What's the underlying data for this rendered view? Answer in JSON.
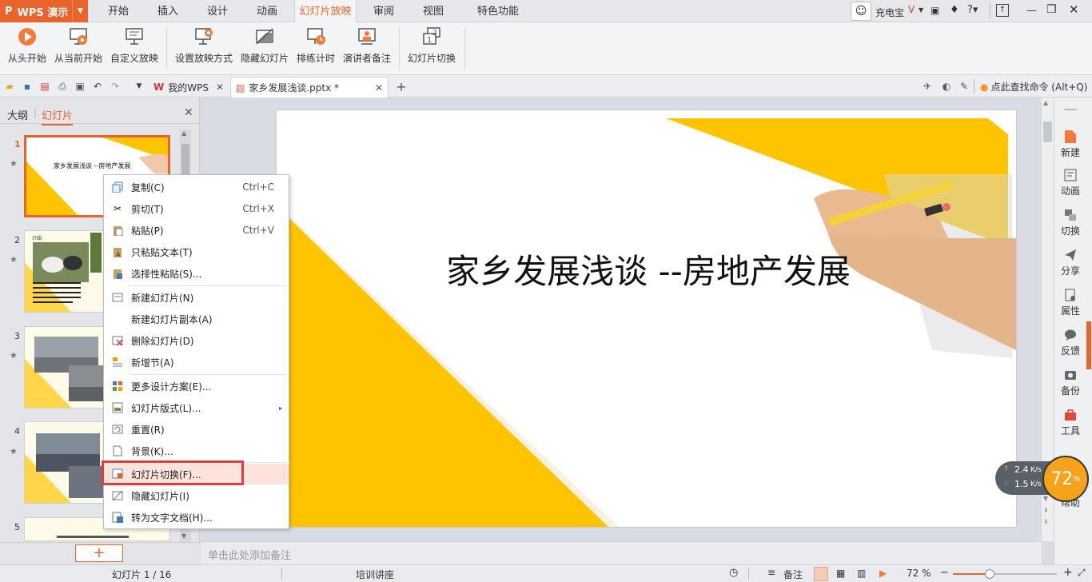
{
  "app": {
    "name": "WPS 演示",
    "logo": "P"
  },
  "tabs": [
    {
      "label": "开始"
    },
    {
      "label": "插入"
    },
    {
      "label": "设计"
    },
    {
      "label": "动画"
    },
    {
      "label": "幻灯片放映",
      "active": true
    },
    {
      "label": "审阅"
    },
    {
      "label": "视图"
    },
    {
      "label": "特色功能"
    }
  ],
  "user": {
    "name": "充电宝"
  },
  "ribbon": {
    "from_start": "从头开始",
    "from_current": "从当前开始",
    "custom_show": "自定义放映",
    "setup_show": "设置放映方式",
    "hide_slide": "隐藏幻灯片",
    "rehearse": "排练计时",
    "presenter_notes": "演讲者备注",
    "slide_transition": "幻灯片切换"
  },
  "doc_tabs": [
    {
      "label": "我的WPS"
    },
    {
      "label": "家乡发展浅谈.pptx *"
    }
  ],
  "command_search": {
    "placeholder": "点此查找命令 (Alt+Q)"
  },
  "left_panel": {
    "outline_tab": "大纲",
    "slides_tab": "幻灯片",
    "slides": [
      {
        "number": "1",
        "title": "家乡发展浅谈 --房地产发展"
      },
      {
        "number": "2",
        "title": "介绍"
      },
      {
        "number": "3"
      },
      {
        "number": "4"
      },
      {
        "number": "5"
      }
    ],
    "add_button": "+"
  },
  "slide": {
    "title": "家乡发展浅谈 --房地产发展"
  },
  "notes_placeholder": "单击此处添加备注",
  "context_menu": {
    "items": [
      {
        "label": "复制(C)",
        "shortcut": "Ctrl+C",
        "icon": "copy-icon"
      },
      {
        "label": "剪切(T)",
        "shortcut": "Ctrl+X",
        "icon": "scissors-icon"
      },
      {
        "label": "粘贴(P)",
        "shortcut": "Ctrl+V",
        "icon": "paste-icon"
      },
      {
        "label": "只粘贴文本(T)",
        "icon": "paste-text-icon"
      },
      {
        "label": "选择性粘贴(S)...",
        "icon": "paste-special-icon"
      },
      {
        "label": "新建幻灯片(N)",
        "icon": "new-slide-icon"
      },
      {
        "label": "新建幻灯片副本(A)"
      },
      {
        "label": "删除幻灯片(D)",
        "icon": "delete-slide-icon"
      },
      {
        "label": "新增节(A)",
        "icon": "section-icon"
      },
      {
        "label": "更多设计方案(E)...",
        "icon": "design-icon"
      },
      {
        "label": "幻灯片版式(L)...",
        "icon": "layout-icon",
        "submenu": true
      },
      {
        "label": "重置(R)",
        "icon": "reset-icon"
      },
      {
        "label": "背景(K)...",
        "icon": "background-icon"
      },
      {
        "label": "幻灯片切换(F)...",
        "icon": "transition-icon",
        "highlighted": true
      },
      {
        "label": "隐藏幻灯片(I)",
        "icon": "hide-slide-icon"
      },
      {
        "label": "转为文字文档(H)...",
        "icon": "to-word-icon"
      }
    ]
  },
  "right_bar": {
    "new": "新建",
    "animation": "动画",
    "transition": "切换",
    "share": "分享",
    "properties": "属性",
    "feedback": "反馈",
    "backup": "备份",
    "tools": "工具",
    "help": "帮助"
  },
  "net_widget": {
    "upload": "2.4",
    "download": "1.5",
    "unit": "K/s",
    "percent": "72",
    "percent_sign": "%"
  },
  "status": {
    "slide_counter": "幻灯片 1 / 16",
    "theme": "培训讲座",
    "notes": "备注",
    "zoom": "72 %"
  },
  "colors": {
    "accent": "#e8642c",
    "slide_yellow": "#ffc400",
    "highlight": "#e43c3c"
  }
}
